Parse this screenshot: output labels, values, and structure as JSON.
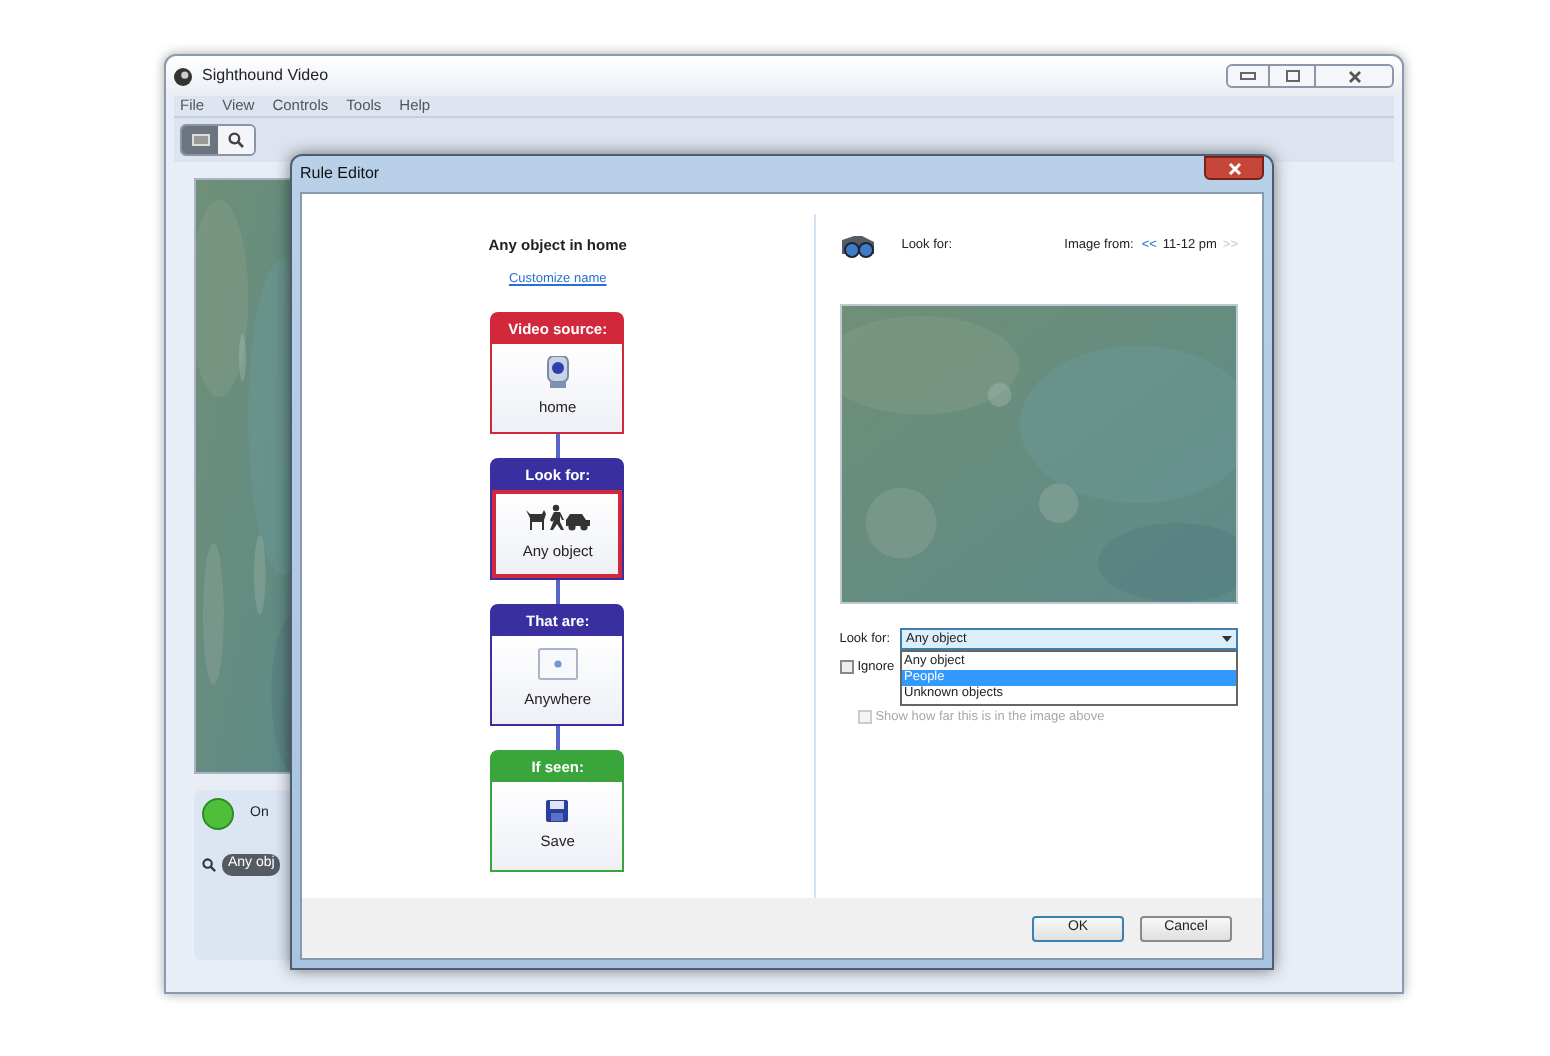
{
  "main_window": {
    "title": "Sighthound Video",
    "menu": [
      "File",
      "View",
      "Controls",
      "Tools",
      "Help"
    ],
    "toolbar": [
      {
        "kind": "view",
        "selected": true
      },
      {
        "kind": "search",
        "selected": false
      }
    ],
    "camera": {
      "status": "On",
      "on": true
    },
    "search_tag": "Any obj"
  },
  "dialog": {
    "title": "Rule Editor",
    "rule_name": "Any object in home",
    "customize_link": "Customize name",
    "steps": [
      {
        "kind": "source",
        "header": "Video source:",
        "label": "home",
        "color": "#d2283c",
        "selected": false
      },
      {
        "kind": "object",
        "header": "Look for:",
        "label": "Any object",
        "color": "#3a2fa0",
        "selected": true
      },
      {
        "kind": "area",
        "header": "That are:",
        "label": "Anywhere",
        "color": "#3a2fa0",
        "selected": false
      },
      {
        "kind": "action",
        "header": "If seen:",
        "label": "Save",
        "color": "#3aa53a",
        "selected": false
      }
    ],
    "preview": {
      "label": "Look for:",
      "image_from_label": "Image from:",
      "prev": "<<",
      "time": "11-12 pm",
      "next": ">>",
      "next_disabled": true
    },
    "look_for": {
      "label": "Look for:",
      "value": "Any object",
      "expanded": true,
      "options": [
        {
          "label": "Any object",
          "highlighted": false
        },
        {
          "label": "People",
          "highlighted": true
        },
        {
          "label": "Unknown objects",
          "highlighted": false
        }
      ]
    },
    "ignore": {
      "label": "Ignore",
      "checked": false
    },
    "show_how": {
      "label": "Show how far this is in the image above",
      "checked": false,
      "disabled": true
    },
    "buttons": [
      {
        "label": "OK",
        "default": true
      },
      {
        "label": "Cancel",
        "default": false
      }
    ]
  }
}
